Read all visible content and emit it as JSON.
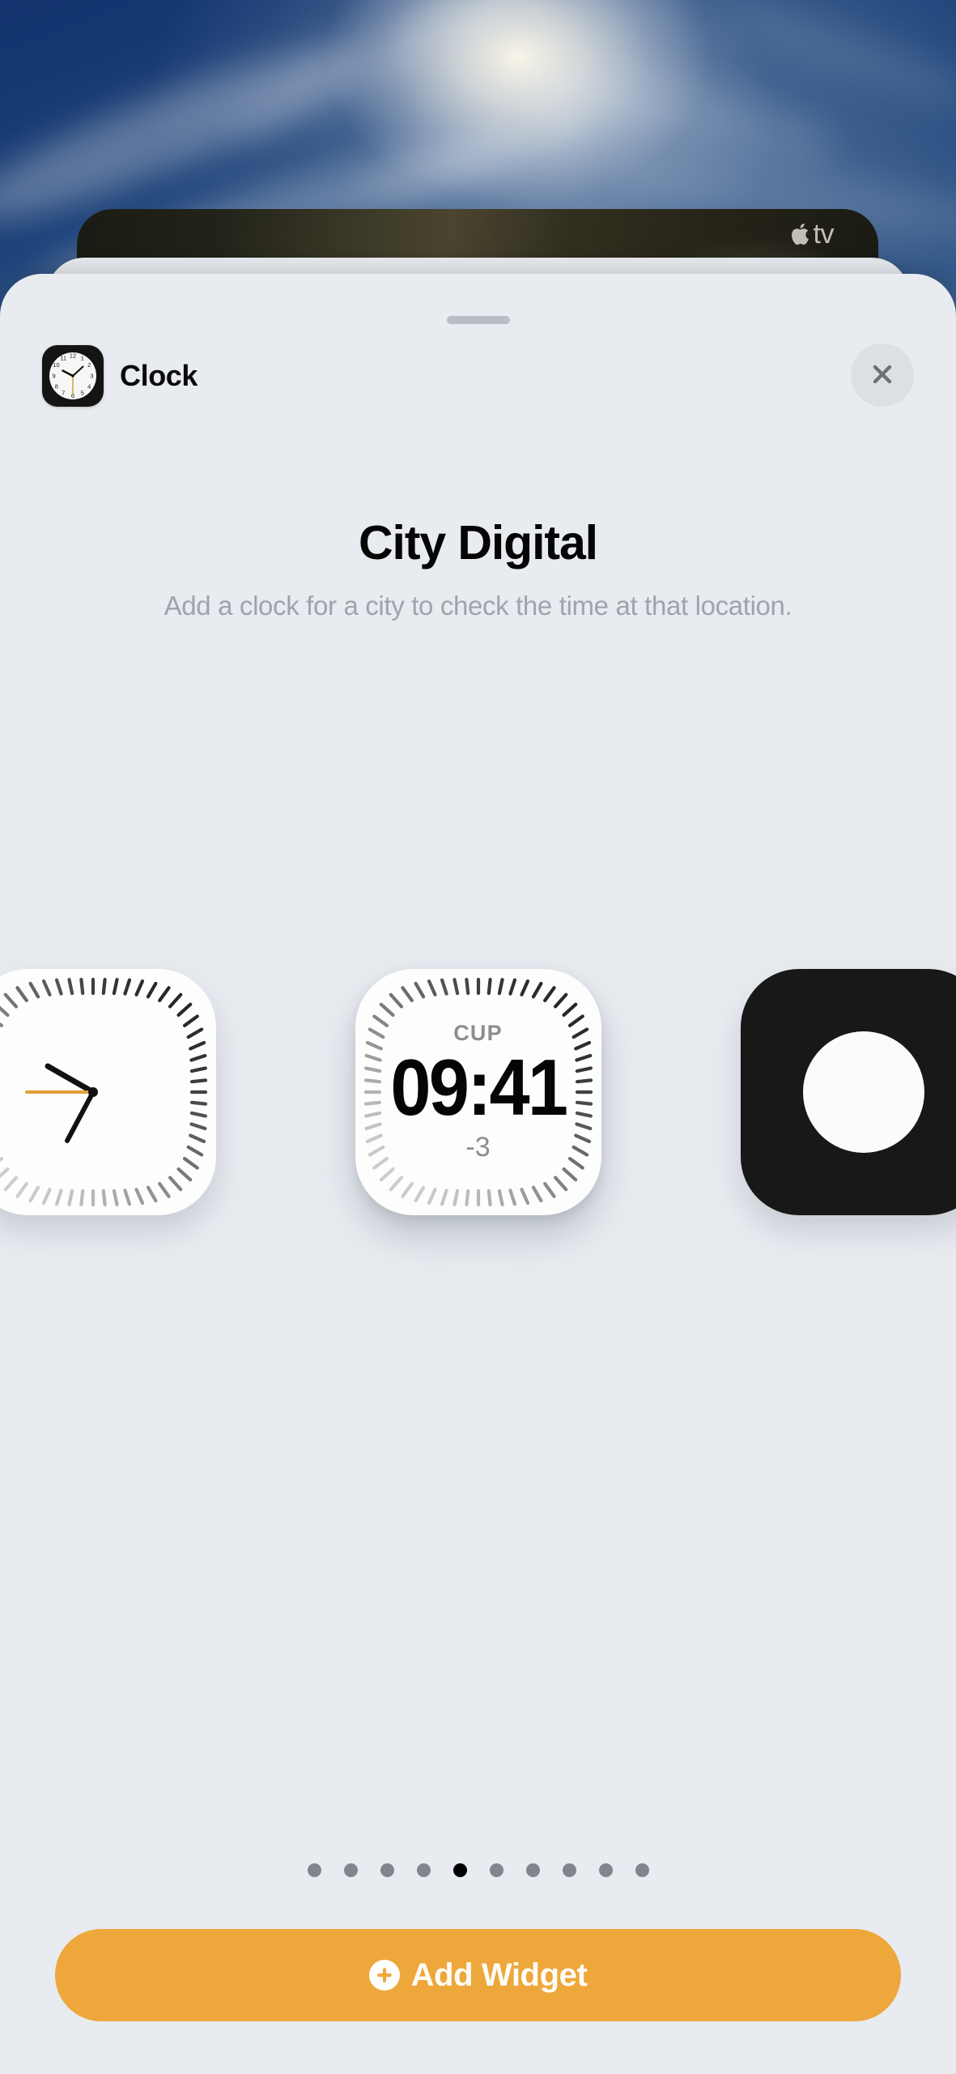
{
  "wallpaper": {
    "description": "sky-with-clouds-and-sun-glow"
  },
  "background_card": {
    "app_label": "tv",
    "logo_icon": "apple-logo-icon"
  },
  "sheet": {
    "grabber": "sheet-grabber-handle",
    "header": {
      "app_name": "Clock",
      "app_icon": "clock-app-icon",
      "close_icon": "close-x-icon",
      "close_label": "Close"
    },
    "widget": {
      "title": "City Digital",
      "description": "Add a clock for a city to check the time at that location."
    },
    "carousel": {
      "previews": [
        {
          "type": "analog-clock",
          "style": "light"
        },
        {
          "type": "city-digital",
          "style": "light"
        },
        {
          "type": "digital-clock",
          "style": "dark"
        }
      ],
      "active_widget": {
        "city": "CUP",
        "time": "09:41",
        "offset": "-3"
      }
    },
    "pagination": {
      "total": 10,
      "active_index": 4
    },
    "footer": {
      "add_button_label": "Add Widget",
      "add_button_icon": "plus-circle-icon"
    }
  },
  "colors": {
    "sheet_bg": "#e8ebf0",
    "accent_orange": "#eda73b",
    "title_text": "#050506",
    "subtitle_text": "#9fa3ab",
    "dot_inactive": "#81858d",
    "dot_active": "#000000",
    "widget_face": "#fdfdfd",
    "widget_secondary_text": "#8c8c91"
  }
}
